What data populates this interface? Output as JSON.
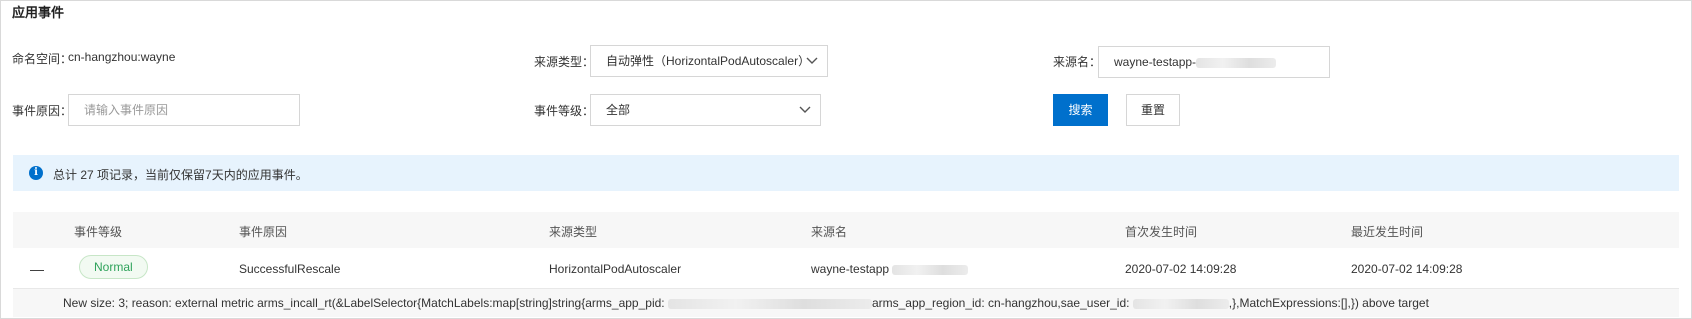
{
  "title": "应用事件",
  "filters": {
    "namespace_label": "命名空间：",
    "namespace_value": "cn-hangzhou:wayne",
    "source_type_label": "来源类型：",
    "source_type_value": "自动弹性（HorizontalPodAutoscaler）",
    "source_name_label": "来源名：",
    "source_name_value": "wayne-testapp-",
    "reason_label": "事件原因：",
    "reason_placeholder": "请输入事件原因",
    "level_label": "事件等级：",
    "level_value": "全部",
    "search_button": "搜索",
    "reset_button": "重置"
  },
  "notice": {
    "icon": "info-icon",
    "text": "总计 27 项记录，当前仅保留7天内的应用事件。"
  },
  "table": {
    "columns": [
      "事件等级",
      "事件原因",
      "来源类型",
      "来源名",
      "首次发生时间",
      "最近发生时间"
    ],
    "rows": [
      {
        "toggle": "—",
        "level": "Normal",
        "reason": "SuccessfulRescale",
        "source_type": "HorizontalPodAutoscaler",
        "source_name": "wayne-testapp",
        "first_time": "2020-07-02 14:09:28",
        "last_time": "2020-07-02 14:09:28",
        "detail_part1": "New size: 3; reason: external metric arms_incall_rt(&LabelSelector{MatchLabels:map[string]string{arms_app_pid: ",
        "detail_part2": "arms_app_region_id: cn-hangzhou,sae_user_id: ",
        "detail_part3": ",},MatchExpressions:[],}) above target"
      }
    ]
  },
  "colors": {
    "primary": "#0070cc",
    "notice_bg": "#e7f3fd",
    "normal_badge": "#2fa35b"
  }
}
